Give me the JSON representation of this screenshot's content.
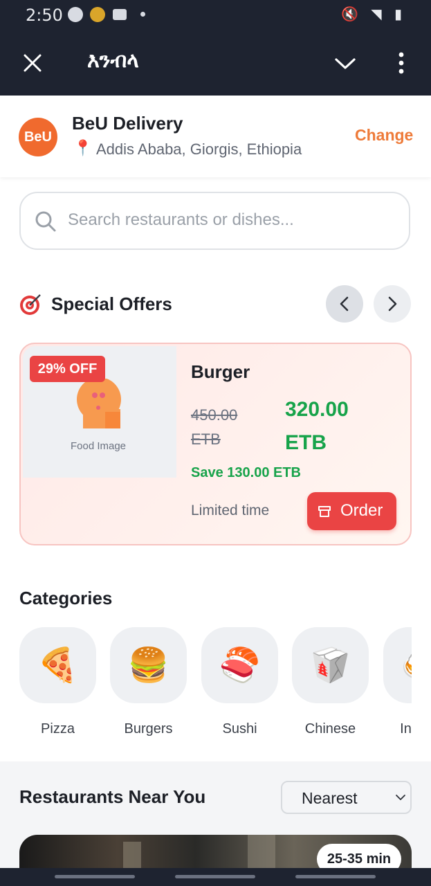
{
  "status_bar": {
    "time": "2:50"
  },
  "app_bar": {
    "title": "እንብላ"
  },
  "header": {
    "logo_text": "BeU",
    "brand": "BeU Delivery",
    "location": "Addis Ababa, Giorgis, Ethiopia",
    "change_label": "Change"
  },
  "search": {
    "placeholder": "Search restaurants or dishes..."
  },
  "offers": {
    "title": "Special Offers",
    "card": {
      "badge": "29% OFF",
      "image_label": "Food Image",
      "name": "Burger",
      "old_price": "450.00 ETB",
      "new_price": "320.00 ETB",
      "save": "Save 130.00 ETB",
      "limited": "Limited time",
      "order_label": "Order"
    }
  },
  "categories": {
    "title": "Categories",
    "items": [
      {
        "label": "Pizza",
        "icon": "🍕"
      },
      {
        "label": "Burgers",
        "icon": "🍔"
      },
      {
        "label": "Sushi",
        "icon": "🍣"
      },
      {
        "label": "Chinese",
        "icon": "🥡"
      },
      {
        "label": "In",
        "icon": "🍛"
      }
    ]
  },
  "restaurants": {
    "title": "Restaurants Near You",
    "sort_value": "Nearest",
    "first_card_time": "25-35 min"
  },
  "colors": {
    "accent": "#f06a2e",
    "danger": "#ea4444",
    "success": "#17a34a",
    "dark_bar": "#1e2330"
  }
}
